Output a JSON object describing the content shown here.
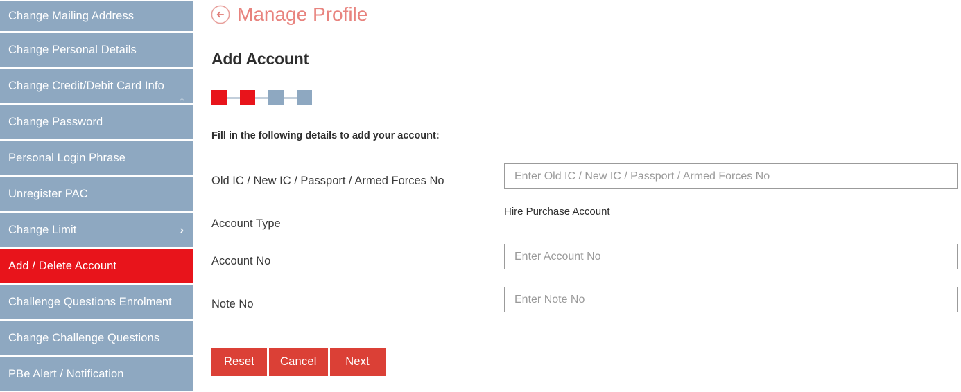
{
  "sidebar": {
    "items": [
      {
        "label": "Change Mailing Address",
        "active": false,
        "chevron": "none"
      },
      {
        "label": "Change Personal Details",
        "active": false,
        "chevron": "none"
      },
      {
        "label": "Change Credit/Debit Card Info",
        "active": false,
        "chevron": "faint"
      },
      {
        "label": "Change Password",
        "active": false,
        "chevron": "none"
      },
      {
        "label": "Personal Login Phrase",
        "active": false,
        "chevron": "none"
      },
      {
        "label": "Unregister PAC",
        "active": false,
        "chevron": "none"
      },
      {
        "label": "Change Limit",
        "active": false,
        "chevron": "right"
      },
      {
        "label": "Add / Delete Account",
        "active": true,
        "chevron": "none"
      },
      {
        "label": "Challenge Questions Enrolment",
        "active": false,
        "chevron": "none"
      },
      {
        "label": "Change Challenge Questions",
        "active": false,
        "chevron": "none"
      },
      {
        "label": "PBe Alert / Notification",
        "active": false,
        "chevron": "none"
      }
    ]
  },
  "header": {
    "breadcrumb": "Manage Profile",
    "back_icon": "circle-arrow-left-icon",
    "title": "Add Account"
  },
  "stepper": {
    "steps": [
      {
        "index": 1,
        "state": "done"
      },
      {
        "index": 2,
        "state": "done"
      },
      {
        "index": 3,
        "state": "pending"
      },
      {
        "index": 4,
        "state": "pending"
      }
    ]
  },
  "form": {
    "instruction": "Fill in the following details to add your account:",
    "fields": [
      {
        "label": "Old IC / New IC / Passport / Armed Forces No",
        "type": "input",
        "value": "",
        "placeholder": "Enter Old IC / New IC / Passport / Armed Forces No"
      },
      {
        "label": "Account Type",
        "type": "static",
        "value": "Hire Purchase Account"
      },
      {
        "label": "Account No",
        "type": "input",
        "value": "",
        "placeholder": "Enter Account No"
      },
      {
        "label": "Note No",
        "type": "input",
        "value": "",
        "placeholder": "Enter Note No"
      }
    ]
  },
  "actions": {
    "reset": "Reset",
    "cancel": "Cancel",
    "next": "Next"
  },
  "colors": {
    "brand_red": "#e8141b",
    "button_red": "#db4036",
    "sidebar_blue": "#8ea8c1",
    "breadcrumb_salmon": "#e8837e",
    "step_line": "#c3cfdb",
    "input_border": "#9b9b9b"
  }
}
